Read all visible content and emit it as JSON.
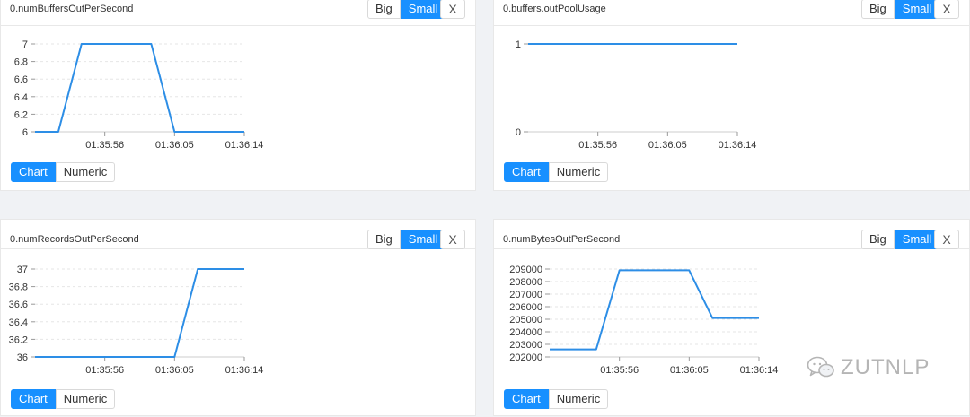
{
  "buttons": {
    "big": "Big",
    "small": "Small",
    "close": "X",
    "chart": "Chart",
    "numeric": "Numeric"
  },
  "colors": {
    "accent": "#1890ff",
    "line": "#2d8ee6",
    "text": "#333333",
    "grid": "#e6e6e6",
    "border": "#e8e8e8"
  },
  "watermark": {
    "text": "ZUTNLP",
    "icon": "wechat-icon"
  },
  "panels": [
    {
      "title": "0.numBuffersOutPerSecond",
      "active_size": "Small",
      "active_mode": "Chart",
      "chart_data": {
        "type": "line",
        "title": "",
        "x_ticks": [
          "01:35:56",
          "01:36:05",
          "01:36:14"
        ],
        "y_ticks": [
          "6",
          "6.2",
          "6.4",
          "6.6",
          "6.8",
          "7"
        ],
        "ylim": [
          6,
          7
        ],
        "xlim": [
          "01:35:47",
          "01:36:14"
        ],
        "grid": true,
        "series": [
          {
            "x": [
              "01:35:47",
              "01:35:50",
              "01:35:53",
              "01:36:02",
              "01:36:05",
              "01:36:08",
              "01:36:14"
            ],
            "y": [
              6,
              6,
              7,
              7,
              6,
              6,
              6
            ]
          }
        ]
      }
    },
    {
      "title": "0.buffers.outPoolUsage",
      "active_size": "Small",
      "active_mode": "Chart",
      "chart_data": {
        "type": "line",
        "title": "",
        "x_ticks": [
          "01:35:56",
          "01:36:05",
          "01:36:14"
        ],
        "y_ticks": [
          "0",
          "1"
        ],
        "ylim": [
          0,
          1
        ],
        "xlim": [
          "01:35:47",
          "01:36:14"
        ],
        "grid": false,
        "series": [
          {
            "x": [
              "01:35:47",
              "01:36:14"
            ],
            "y": [
              1,
              1
            ]
          }
        ]
      }
    },
    {
      "title": "0.numRecordsOutPerSecond",
      "active_size": "Small",
      "active_mode": "Chart",
      "chart_data": {
        "type": "line",
        "title": "",
        "x_ticks": [
          "01:35:56",
          "01:36:05",
          "01:36:14"
        ],
        "y_ticks": [
          "36",
          "36.2",
          "36.4",
          "36.6",
          "36.8",
          "37"
        ],
        "ylim": [
          36,
          37
        ],
        "xlim": [
          "01:35:47",
          "01:36:14"
        ],
        "grid": true,
        "series": [
          {
            "x": [
              "01:35:47",
              "01:36:05",
              "01:36:08",
              "01:36:14"
            ],
            "y": [
              36,
              36,
              37,
              37
            ]
          }
        ]
      }
    },
    {
      "title": "0.numBytesOutPerSecond",
      "active_size": "Small",
      "active_mode": "Chart",
      "chart_data": {
        "type": "line",
        "title": "",
        "x_ticks": [
          "01:35:56",
          "01:36:05",
          "01:36:14"
        ],
        "y_ticks": [
          "202000",
          "203000",
          "204000",
          "205000",
          "206000",
          "207000",
          "208000",
          "209000"
        ],
        "ylim": [
          202000,
          209000
        ],
        "xlim": [
          "01:35:47",
          "01:36:14"
        ],
        "grid": true,
        "series": [
          {
            "x": [
              "01:35:47",
              "01:35:53",
              "01:35:56",
              "01:36:02",
              "01:36:05",
              "01:36:08",
              "01:36:14"
            ],
            "y": [
              202600,
              202600,
              208900,
              208900,
              208900,
              205100,
              205100
            ]
          }
        ]
      }
    }
  ]
}
